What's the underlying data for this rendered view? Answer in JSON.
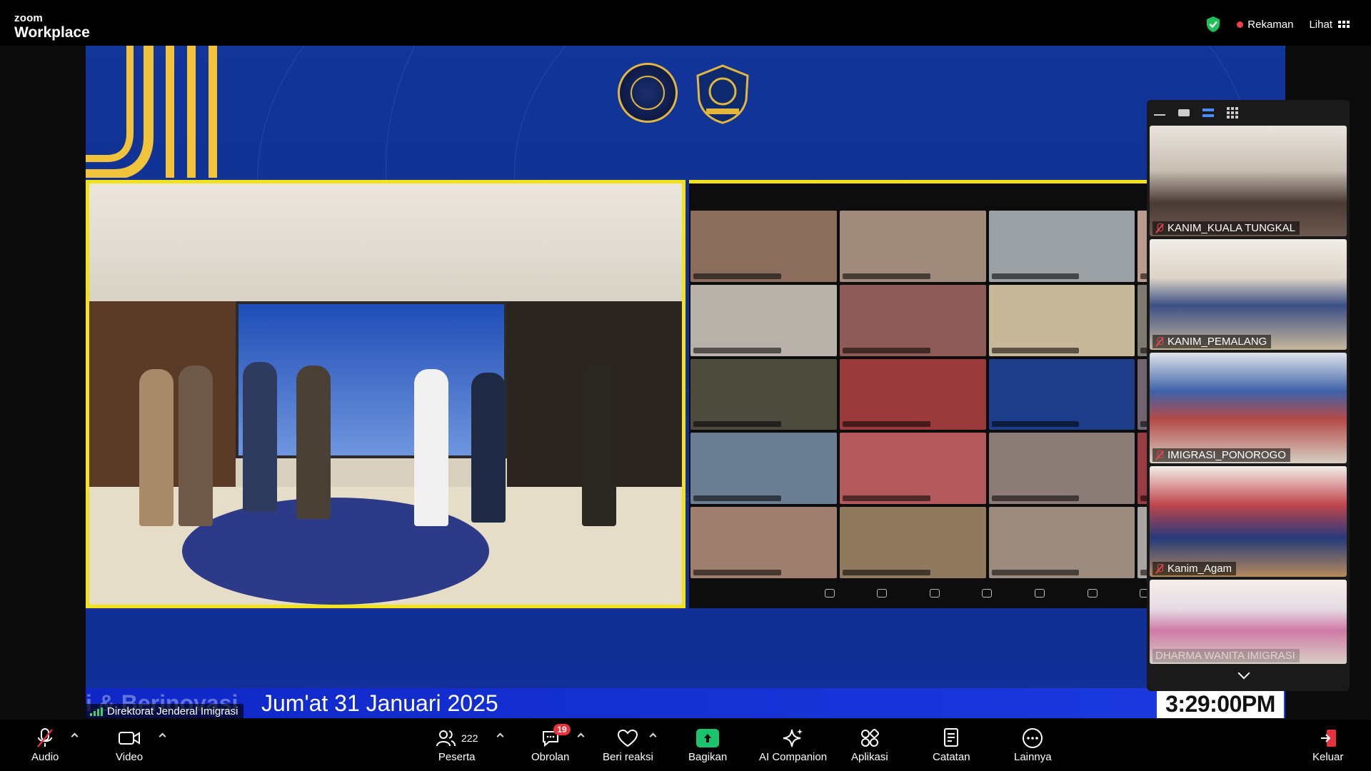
{
  "app": {
    "brand_top": "zoom",
    "brand_bottom": "Workplace"
  },
  "topbar": {
    "record_label": "Rekaman",
    "view_label": "Lihat"
  },
  "stage": {
    "banner_left": "i & Berinovasi",
    "banner_date": "Jum'at 31 Januari 2025",
    "clock": "3:29:00PM",
    "speaker_name": "Direktorat Jenderal Imigrasi"
  },
  "participants": [
    {
      "name": "KANIM_KUALA TUNGKAL"
    },
    {
      "name": "KANIM_PEMALANG"
    },
    {
      "name": "IMIGRASI_PONOROGO"
    },
    {
      "name": "Kanim_Agam"
    },
    {
      "name": "DHARMA WANITA IMIGRASI"
    }
  ],
  "toolbar": {
    "audio": "Audio",
    "video": "Video",
    "participants": "Peserta",
    "participants_count": "222",
    "chat": "Obrolan",
    "chat_badge": "19",
    "react": "Beri reaksi",
    "share": "Bagikan",
    "ai": "AI Companion",
    "apps": "Aplikasi",
    "notes": "Catatan",
    "more": "Lainnya",
    "leave": "Keluar"
  },
  "colors": {
    "accent": "#f3e21b",
    "share_green": "#19c46a",
    "rec_red": "#f0414b"
  }
}
